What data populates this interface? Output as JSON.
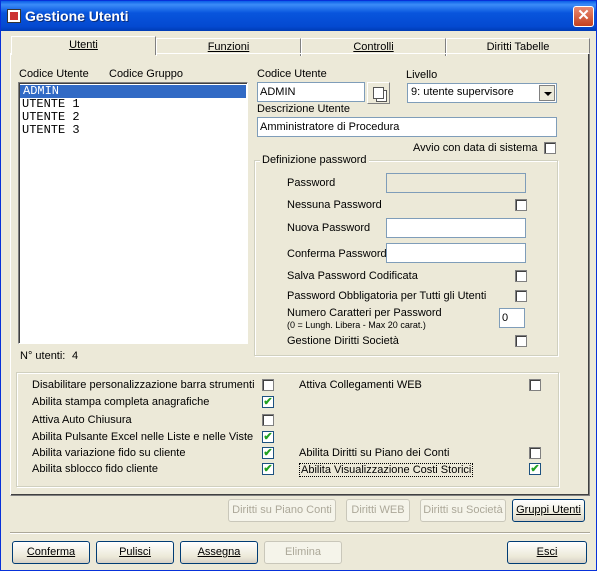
{
  "window": {
    "title": "Gestione Utenti",
    "close_label": "✕"
  },
  "tabs": [
    {
      "label": "Utenti",
      "active": true
    },
    {
      "label": "Funzioni",
      "active": false
    },
    {
      "label": "Controlli",
      "active": false
    },
    {
      "label": "Diritti Tabelle",
      "active": false
    }
  ],
  "list": {
    "header_code": "Codice Utente",
    "header_group": "Codice Gruppo",
    "items": [
      "ADMIN",
      "UTENTE 1",
      "UTENTE 2",
      "UTENTE 3"
    ],
    "selected_index": 0,
    "count_label": "N° utenti:",
    "count_value": "4"
  },
  "user": {
    "code_label": "Codice Utente",
    "code_value": "ADMIN",
    "level_label": "Livello",
    "level_value": "9: utente supervisore",
    "desc_label": "Descrizione Utente",
    "desc_value": "Amministratore di Procedura",
    "sysdate_label": "Avvio con data di sistema",
    "sysdate_checked": false
  },
  "password": {
    "group_label": "Definizione password",
    "password_label": "Password",
    "no_password_label": "Nessuna Password",
    "new_password_label": "Nuova Password",
    "confirm_password_label": "Conferma Password",
    "save_encoded_label": "Salva Password Codificata",
    "mandatory_label": "Password Obbligatoria per Tutti gli Utenti",
    "num_chars_label": "Numero Caratteri per Password",
    "num_chars_note": "(0 = Lungh. Libera - Max 20 carat.)",
    "num_chars_value": "0",
    "company_rights_label": "Gestione Diritti Società"
  },
  "options": {
    "left": [
      {
        "label": "Disabilitare personalizzazione barra strumenti",
        "checked": false
      },
      {
        "label": "Abilita stampa completa anagrafiche",
        "checked": true
      },
      {
        "label": "Attiva Auto Chiusura",
        "checked": false
      },
      {
        "label": "Abilita Pulsante Excel nelle Liste e nelle Viste",
        "checked": true
      },
      {
        "label": "Abilita variazione fido su cliente",
        "checked": true
      },
      {
        "label": "Abilita sblocco fido cliente",
        "checked": true
      }
    ],
    "right": [
      {
        "label": "Attiva Collegamenti WEB",
        "checked": false
      },
      {
        "label": "Abilita Diritti su Piano dei Conti",
        "checked": false
      },
      {
        "label": "Abilita Visualizzazione Costi Storici",
        "checked": true
      }
    ]
  },
  "rights_buttons": {
    "chart_of_accounts": "Diritti su Piano Conti",
    "web": "Diritti WEB",
    "company": "Diritti su Società",
    "groups": "Gruppi Utenti"
  },
  "footer": {
    "confirm": "Conferma",
    "clear": "Pulisci",
    "assign": "Assegna",
    "delete": "Elimina",
    "exit": "Esci"
  }
}
